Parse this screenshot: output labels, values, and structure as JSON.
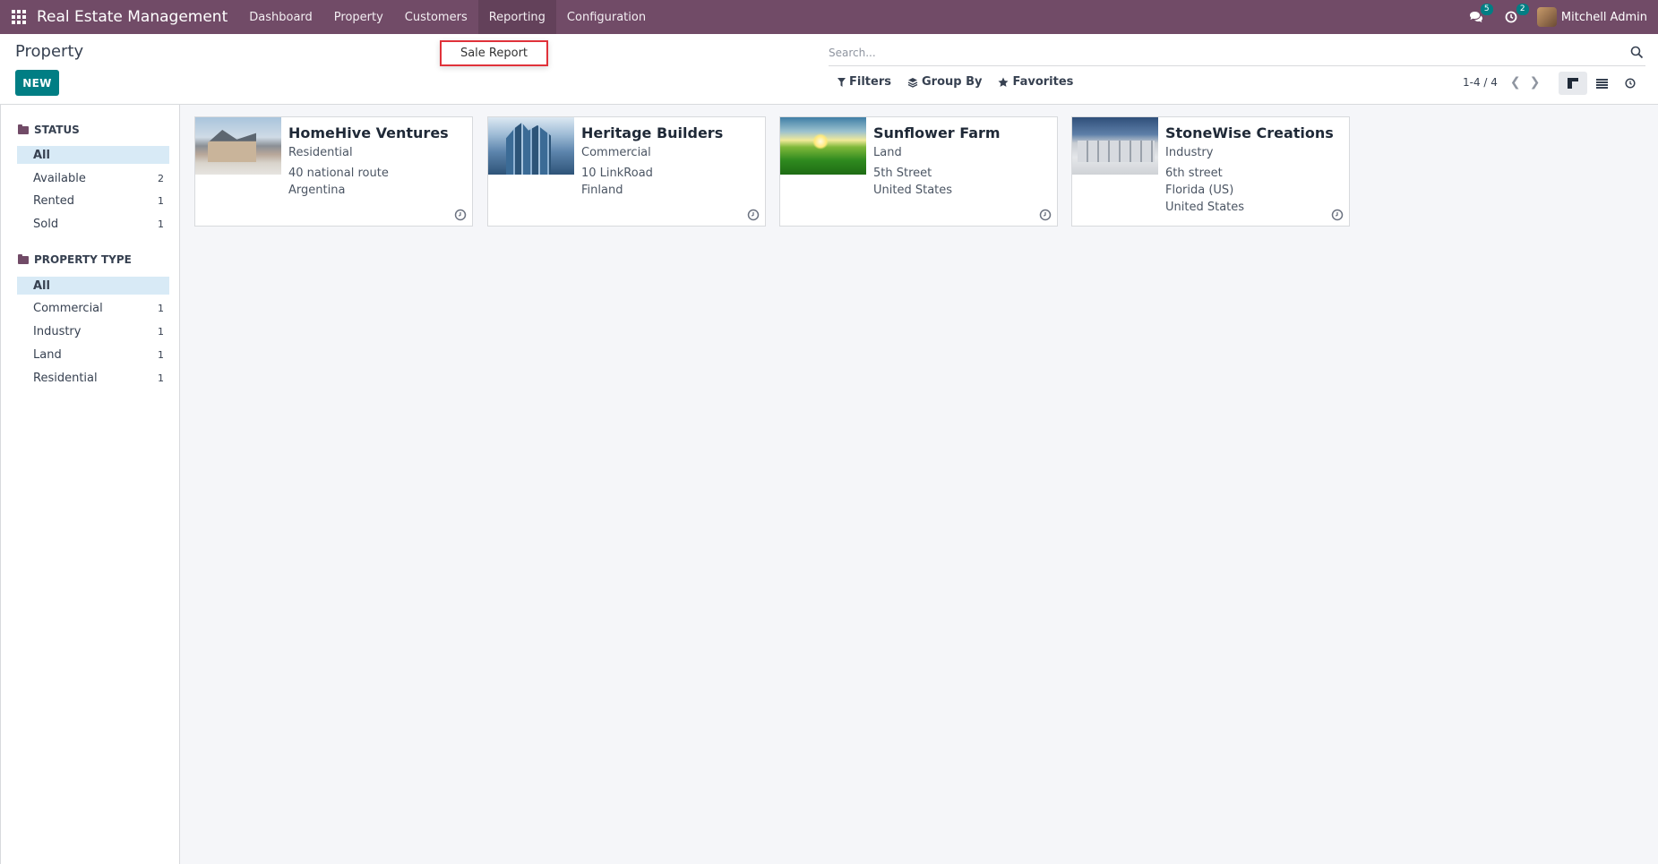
{
  "navbar": {
    "app_name": "Real Estate Management",
    "menu": [
      "Dashboard",
      "Property",
      "Customers",
      "Reporting",
      "Configuration"
    ],
    "messages_count": "5",
    "activities_count": "2",
    "user_name": "Mitchell Admin"
  },
  "dropdown": {
    "item": "Sale Report"
  },
  "control_panel": {
    "title": "Property",
    "new_label": "NEW",
    "search_placeholder": "Search...",
    "filters_label": "Filters",
    "groupby_label": "Group By",
    "favorites_label": "Favorites",
    "pager": "1-4 / 4"
  },
  "sidebar": {
    "status_header": "STATUS",
    "status_items": [
      {
        "label": "All",
        "count": ""
      },
      {
        "label": "Available",
        "count": "2"
      },
      {
        "label": "Rented",
        "count": "1"
      },
      {
        "label": "Sold",
        "count": "1"
      }
    ],
    "type_header": "PROPERTY TYPE",
    "type_items": [
      {
        "label": "All",
        "count": ""
      },
      {
        "label": "Commercial",
        "count": "1"
      },
      {
        "label": "Industry",
        "count": "1"
      },
      {
        "label": "Land",
        "count": "1"
      },
      {
        "label": "Residential",
        "count": "1"
      }
    ]
  },
  "cards": [
    {
      "title": "HomeHive Ventures",
      "type": "Residential",
      "lines": [
        "40 national route",
        "Argentina",
        ""
      ]
    },
    {
      "title": "Heritage Builders",
      "type": "Commercial",
      "lines": [
        "10 LinkRoad",
        "Finland",
        ""
      ]
    },
    {
      "title": "Sunflower Farm",
      "type": "Land",
      "lines": [
        "5th Street",
        "United States",
        ""
      ]
    },
    {
      "title": "StoneWise Creations",
      "type": "Industry",
      "lines": [
        "6th street",
        "Florida (US)",
        "United States"
      ]
    }
  ],
  "colors": {
    "navbar": "#714b67",
    "primary_button": "#017e84",
    "highlight": "#e0323a",
    "selected_filter": "#d8eaf6"
  }
}
